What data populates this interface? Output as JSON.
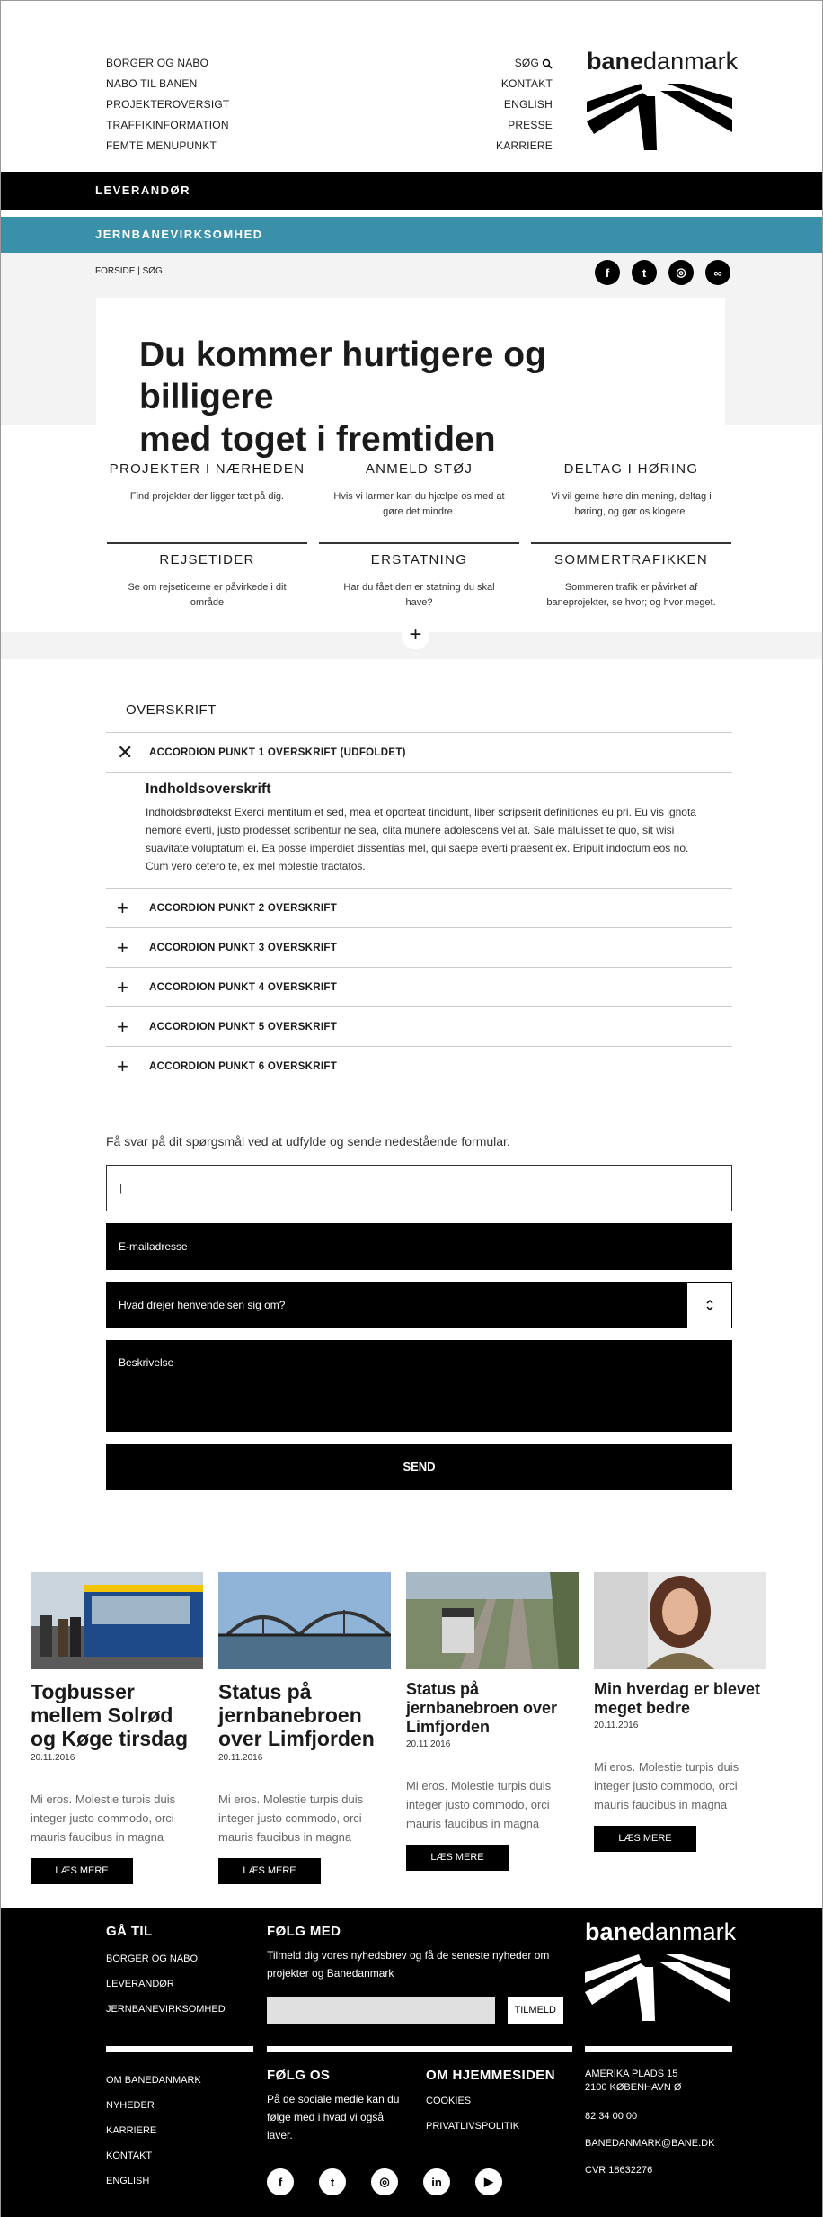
{
  "header": {
    "left_links": [
      "BORGER OG NABO",
      "NABO TIL BANEN",
      "PROJEKTEROVERSIGT",
      "TRAFFIKINFORMATION",
      "FEMTE MENUPUNKT"
    ],
    "search_label": "SØG",
    "right_links": [
      "KONTAKT",
      "ENGLISH",
      "PRESSE",
      "KARRIERE"
    ],
    "logo_bold": "bane",
    "logo_regular": "danmark"
  },
  "nav": {
    "primary": "LEVERANDØR",
    "secondary": "JERNBANEVIRKSOMHED"
  },
  "hero": {
    "breadcrumb": "FORSIDE | SØG",
    "title_line1": "Du kommer hurtigere og billigere",
    "title_line2": "med toget i fremtiden",
    "socials": [
      "facebook-icon",
      "twitter-icon",
      "instagram-icon",
      "link-icon"
    ]
  },
  "tiles": [
    {
      "title": "PROJEKTER I NÆRHEDEN",
      "text": "Find projekter der ligger tæt på dig."
    },
    {
      "title": "ANMELD STØJ",
      "text": "Hvis vi larmer kan du hjælpe os med at gøre det mindre."
    },
    {
      "title": "DELTAG I HØRING",
      "text": "Vi vil gerne høre din mening, deltag i høring, og gør os klogere."
    },
    {
      "title": "REJSETIDER",
      "text": "Se om rejsetiderne er påvirkede i dit område"
    },
    {
      "title": "ERSTATNING",
      "text": "Har du fået den er statning du skal have?"
    },
    {
      "title": "SOMMERTRAFIKKEN",
      "text": "Sommeren trafik er påvirket af baneprojekter, se hvor; og hvor meget."
    }
  ],
  "expand_symbol": "+",
  "accordion": {
    "title": "OVERSKRIFT",
    "open_label": "ACCORDION PUNKT 1 OVERSKRIFT (UDFOLDET)",
    "open_symbol": "✕",
    "body_title": "Indholdsoverskrift",
    "body_text": "Indholdsbrødtekst Exerci mentitum et sed, mea et oporteat tincidunt, liber scripserit definitiones eu pri. Eu vis ignota nemore everti, justo prodesset scribentur ne sea, clita munere adolescens vel at. Sale maluisset te quo, sit wisi suavitate voluptatum ei. Ea posse imperdiet dissentias mel, qui saepe everti praesent ex. Eripuit indoctum eos no. Cum vero cetero te, ex mel molestie tractatos.",
    "closed_symbol": "+",
    "items": [
      "ACCORDION PUNKT 2 OVERSKRIFT",
      "ACCORDION PUNKT 3 OVERSKRIFT",
      "ACCORDION PUNKT 4 OVERSKRIFT",
      "ACCORDION PUNKT 5 OVERSKRIFT",
      "ACCORDION PUNKT 6 OVERSKRIFT"
    ]
  },
  "form": {
    "intro": "Få svar på dit spørgsmål ved at udfylde og sende nedestående formular.",
    "name_value": "|",
    "email_placeholder": "E-mailadresse",
    "subject_placeholder": "Hvad drejer henvendelsen sig om?",
    "description_placeholder": "Beskrivelse",
    "send_label": "SEND"
  },
  "news": [
    {
      "title": "Togbusser mellem Solrød og Køge tirsdag",
      "date": "20.11.2016",
      "text": "Mi eros. Molestie turpis duis integer justo commodo, orci mauris faucibus in magna",
      "button": "LÆS MERE"
    },
    {
      "title": "Status på jernbanebroen over Limfjorden",
      "date": "20.11.2016",
      "text": "Mi eros. Molestie turpis duis integer justo commodo, orci mauris faucibus in magna",
      "button": "LÆS MERE"
    },
    {
      "title": "Status på jernbanebroen over Limfjorden",
      "date": "20.11.2016",
      "text": "Mi eros. Molestie turpis duis integer justo commodo, orci mauris faucibus in magna",
      "button": "LÆS MERE"
    },
    {
      "title": "Min hverdag er blevet meget bedre",
      "date": "20.11.2016",
      "text": "Mi eros. Molestie turpis duis integer justo commodo, orci mauris faucibus in magna",
      "button": "LÆS MERE"
    }
  ],
  "footer": {
    "goto_title": "GÅ TIL",
    "goto_links": [
      "BORGER OG NABO",
      "LEVERANDØR",
      "JERNBANEVIRKSOMHED"
    ],
    "follow_title": "FØLG MED",
    "follow_text": "Tilmeld dig vores nyhedsbrev og få de seneste nyheder om projekter og Banedanmark",
    "newsletter_button": "TILMELD",
    "about_links": [
      "OM BANEDANMARK",
      "NYHEDER",
      "KARRIERE",
      "KONTAKT",
      "ENGLISH"
    ],
    "followus_title": "FØLG OS",
    "followus_text": "På de sociale medie kan du følge med i hvad vi også laver.",
    "site_title": "OM HJEMMESIDEN",
    "site_links": [
      "COOKIES",
      "PRIVATLIVSPOLITIK"
    ],
    "address": [
      "AMERIKA PLADS 15",
      "2100 KØBENHAVN Ø"
    ],
    "phone": "82 34 00 00",
    "email": "BANEDANMARK@BANE.DK",
    "cvr": "CVR 18632276",
    "socials": [
      "facebook-icon",
      "twitter-icon",
      "instagram-icon",
      "linkedin-icon",
      "youtube-icon"
    ],
    "logo_bold": "bane",
    "logo_regular": "danmark"
  },
  "colors": {
    "teal": "#3a8fa9",
    "black": "#000000",
    "light_gray": "#f3f3f3"
  }
}
